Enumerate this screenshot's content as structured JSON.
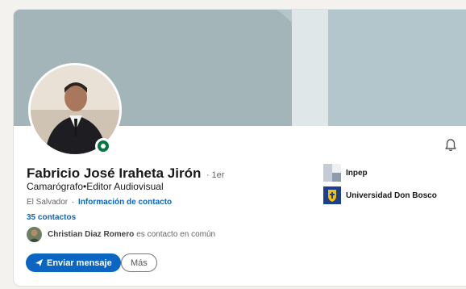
{
  "profile": {
    "name": "Fabricio José Iraheta Jirón",
    "degree": "· 1er",
    "headline": "Camarógrafo•Editor Audiovisual",
    "location": "El Salvador",
    "separator": "·",
    "contact_info_link": "Información de contacto",
    "connections": "35 contactos"
  },
  "mutual": {
    "name": "Christian Diaz Romero",
    "suffix": "es contacto en común"
  },
  "actions": {
    "message_label": "Enviar mensaje",
    "more_label": "Más"
  },
  "organizations": [
    {
      "label": "Inpep",
      "icon": "inpep-logo-icon"
    },
    {
      "label": "Universidad Don Bosco",
      "icon": "don-bosco-logo-icon"
    }
  ],
  "colors": {
    "accent": "#0a66c2",
    "open_to_work": "#057642",
    "banner": "#b3c6cb"
  },
  "icons": {
    "notification": "bell-icon",
    "message": "send-icon"
  }
}
